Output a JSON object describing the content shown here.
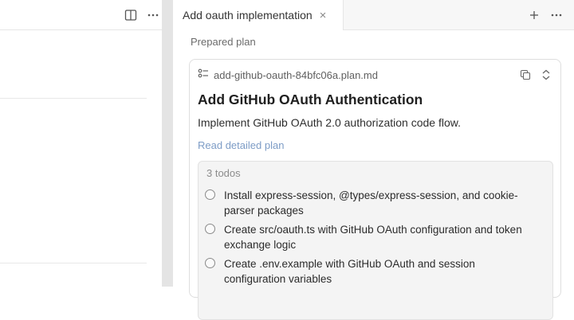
{
  "left_toolbar": {
    "icons": [
      "split-panel-icon",
      "more-icon"
    ]
  },
  "tab": {
    "title": "Add oauth implementation",
    "close_glyph": "×"
  },
  "tabbar_actions": {
    "add_glyph": "+",
    "more_glyph": "···"
  },
  "section_label": "Prepared plan",
  "plan": {
    "file_name": "add-github-oauth-84bfc06a.plan.md",
    "title": "Add GitHub OAuth Authentication",
    "description": "Implement GitHub OAuth 2.0 authorization code flow.",
    "link": "Read detailed plan"
  },
  "todos": {
    "header": "3 todos",
    "items": [
      {
        "text": "Install express-session, @types/express-session, and cookie-parser packages",
        "done": false
      },
      {
        "text": "Create src/oauth.ts with GitHub OAuth configuration and token exchange logic",
        "done": false
      },
      {
        "text": "Create .env.example with GitHub OAuth and session configuration variables",
        "done": false
      }
    ]
  },
  "colors": {
    "link": "#7d9cc6",
    "splitter": "#e4e4e4",
    "todo_bg": "#f4f4f4"
  }
}
